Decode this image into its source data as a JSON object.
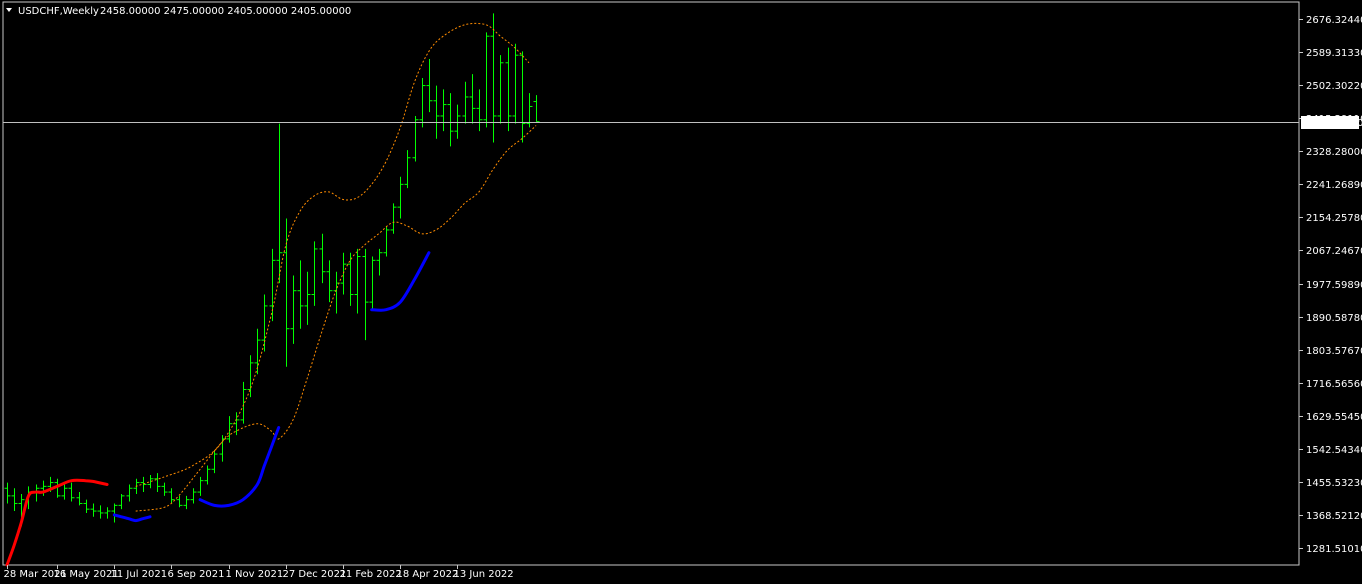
{
  "header": {
    "menu_icon": "triangle-down-icon",
    "title": "USDCHF,Weekly",
    "ohlc": "2458.00000 2475.00000 2405.00000 2405.00000"
  },
  "colors": {
    "background": "#000000",
    "frame": "#c8c8c8",
    "bars": "#00ff00",
    "envelope": "#ff8c00",
    "segment_red": "#ff0000",
    "segment_blue": "#0000ff",
    "current_line": "#c0c0c0",
    "axis_text": "#ffffff",
    "price_label_bg": "#ffffff",
    "price_label_text": "#000000"
  },
  "chart_data": {
    "type": "ohlc",
    "symbol": "USDCHF",
    "timeframe": "Weekly",
    "current_price": 2405.0,
    "current_price_label": "2405.00000",
    "ylim": [
      1238,
      2720
    ],
    "y_ticks": [
      "2676.32440",
      "2589.31330",
      "2502.30220",
      "2415.29110",
      "2328.28000",
      "2241.26890",
      "2154.25780",
      "2067.24670",
      "1977.59890",
      "1890.58780",
      "1803.57670",
      "1716.56560",
      "1629.55450",
      "1542.54340",
      "1455.53230",
      "1368.52120",
      "1281.51010"
    ],
    "x_labels": [
      {
        "label": "28 Mar 2021",
        "bar": 0
      },
      {
        "label": "16 May 2021",
        "bar": 7
      },
      {
        "label": "11 Jul 2021",
        "bar": 15
      },
      {
        "label": "6 Sep 2021",
        "bar": 23
      },
      {
        "label": "1 Nov 2021",
        "bar": 31
      },
      {
        "label": "27 Dec 2021",
        "bar": 39
      },
      {
        "label": "21 Feb 2022",
        "bar": 47
      },
      {
        "label": "18 Apr 2022",
        "bar": 55
      },
      {
        "label": "13 Jun 2022",
        "bar": 63
      }
    ],
    "bars": [
      [
        1440,
        1455,
        1400,
        1420
      ],
      [
        1420,
        1440,
        1380,
        1400
      ],
      [
        1400,
        1425,
        1340,
        1410
      ],
      [
        1410,
        1445,
        1385,
        1430
      ],
      [
        1430,
        1450,
        1405,
        1440
      ],
      [
        1440,
        1460,
        1420,
        1445
      ],
      [
        1445,
        1470,
        1430,
        1455
      ],
      [
        1455,
        1465,
        1415,
        1420
      ],
      [
        1420,
        1450,
        1410,
        1440
      ],
      [
        1440,
        1455,
        1405,
        1415
      ],
      [
        1415,
        1430,
        1395,
        1400
      ],
      [
        1400,
        1410,
        1375,
        1385
      ],
      [
        1385,
        1400,
        1365,
        1380
      ],
      [
        1380,
        1395,
        1360,
        1375
      ],
      [
        1375,
        1390,
        1360,
        1380
      ],
      [
        1380,
        1400,
        1350,
        1395
      ],
      [
        1395,
        1425,
        1385,
        1420
      ],
      [
        1420,
        1450,
        1405,
        1440
      ],
      [
        1440,
        1465,
        1425,
        1455
      ],
      [
        1455,
        1470,
        1430,
        1450
      ],
      [
        1450,
        1475,
        1440,
        1465
      ],
      [
        1465,
        1480,
        1430,
        1445
      ],
      [
        1445,
        1455,
        1420,
        1430
      ],
      [
        1430,
        1440,
        1400,
        1410
      ],
      [
        1410,
        1420,
        1390,
        1395
      ],
      [
        1395,
        1420,
        1385,
        1410
      ],
      [
        1410,
        1440,
        1400,
        1430
      ],
      [
        1430,
        1470,
        1420,
        1460
      ],
      [
        1460,
        1500,
        1450,
        1490
      ],
      [
        1490,
        1540,
        1480,
        1530
      ],
      [
        1530,
        1580,
        1510,
        1570
      ],
      [
        1570,
        1630,
        1560,
        1610
      ],
      [
        1610,
        1640,
        1580,
        1620
      ],
      [
        1620,
        1720,
        1610,
        1700
      ],
      [
        1700,
        1790,
        1680,
        1770
      ],
      [
        1770,
        1860,
        1740,
        1830
      ],
      [
        1830,
        1950,
        1800,
        1920
      ],
      [
        1920,
        2070,
        1880,
        2040
      ],
      [
        2040,
        2400,
        1980,
        2060
      ],
      [
        2060,
        2150,
        1760,
        1860
      ],
      [
        1860,
        2000,
        1820,
        1960
      ],
      [
        1960,
        2040,
        1860,
        1920
      ],
      [
        1920,
        2010,
        1870,
        1950
      ],
      [
        1950,
        2090,
        1920,
        2070
      ],
      [
        2070,
        2110,
        1980,
        2010
      ],
      [
        2010,
        2040,
        1930,
        1960
      ],
      [
        1960,
        2010,
        1900,
        1980
      ],
      [
        1980,
        2060,
        1950,
        2030
      ],
      [
        2030,
        2060,
        1920,
        1950
      ],
      [
        1950,
        2070,
        1900,
        2050
      ],
      [
        2050,
        2070,
        1830,
        1930
      ],
      [
        1930,
        2050,
        1910,
        2040
      ],
      [
        2040,
        2070,
        2000,
        2060
      ],
      [
        2060,
        2130,
        2050,
        2120
      ],
      [
        2120,
        2190,
        2110,
        2180
      ],
      [
        2180,
        2260,
        2150,
        2240
      ],
      [
        2240,
        2330,
        2230,
        2310
      ],
      [
        2310,
        2420,
        2300,
        2410
      ],
      [
        2410,
        2520,
        2390,
        2500
      ],
      [
        2500,
        2570,
        2430,
        2460
      ],
      [
        2460,
        2500,
        2360,
        2420
      ],
      [
        2420,
        2490,
        2380,
        2450
      ],
      [
        2450,
        2480,
        2340,
        2380
      ],
      [
        2380,
        2450,
        2360,
        2420
      ],
      [
        2420,
        2510,
        2400,
        2470
      ],
      [
        2470,
        2530,
        2400,
        2440
      ],
      [
        2440,
        2490,
        2380,
        2410
      ],
      [
        2410,
        2640,
        2390,
        2630
      ],
      [
        2630,
        2690,
        2350,
        2420
      ],
      [
        2420,
        2580,
        2400,
        2560
      ],
      [
        2560,
        2600,
        2380,
        2420
      ],
      [
        2420,
        2610,
        2400,
        2580
      ],
      [
        2580,
        2590,
        2350,
        2400
      ],
      [
        2400,
        2480,
        2390,
        2445
      ],
      [
        2458,
        2475,
        2405,
        2405
      ]
    ],
    "envelope_upper_knots": [
      [
        18,
        1445
      ],
      [
        22,
        1470
      ],
      [
        26,
        1500
      ],
      [
        30,
        1560
      ],
      [
        34,
        1700
      ],
      [
        37,
        1900
      ],
      [
        39,
        2080
      ],
      [
        41,
        2170
      ],
      [
        43,
        2210
      ],
      [
        45,
        2220
      ],
      [
        47,
        2200
      ],
      [
        49,
        2205
      ],
      [
        51,
        2240
      ],
      [
        53,
        2300
      ],
      [
        55,
        2390
      ],
      [
        57,
        2510
      ],
      [
        59,
        2590
      ],
      [
        61,
        2630
      ],
      [
        64,
        2660
      ],
      [
        67,
        2660
      ],
      [
        69,
        2630
      ],
      [
        71,
        2600
      ],
      [
        73,
        2560
      ]
    ],
    "envelope_lower_knots": [
      [
        18,
        1380
      ],
      [
        22,
        1390
      ],
      [
        24,
        1420
      ],
      [
        27,
        1490
      ],
      [
        30,
        1560
      ],
      [
        32,
        1590
      ],
      [
        35,
        1610
      ],
      [
        37,
        1590
      ],
      [
        38,
        1570
      ],
      [
        40,
        1620
      ],
      [
        42,
        1730
      ],
      [
        44,
        1850
      ],
      [
        46,
        1960
      ],
      [
        48,
        2040
      ],
      [
        50,
        2080
      ],
      [
        52,
        2110
      ],
      [
        54,
        2140
      ],
      [
        56,
        2130
      ],
      [
        58,
        2110
      ],
      [
        60,
        2120
      ],
      [
        62,
        2150
      ],
      [
        64,
        2190
      ],
      [
        66,
        2220
      ],
      [
        68,
        2280
      ],
      [
        70,
        2330
      ],
      [
        72,
        2360
      ],
      [
        74,
        2395
      ]
    ],
    "red_segment_knots": [
      [
        0,
        1238
      ],
      [
        1,
        1290
      ],
      [
        2,
        1350
      ],
      [
        3,
        1420
      ],
      [
        4,
        1430
      ],
      [
        5,
        1430
      ],
      [
        7,
        1445
      ],
      [
        9,
        1460
      ],
      [
        11,
        1460
      ],
      [
        12,
        1458
      ],
      [
        14,
        1450
      ]
    ],
    "blue_segment_1_knots": [
      [
        15,
        1370
      ],
      [
        16,
        1365
      ],
      [
        17,
        1360
      ],
      [
        18,
        1355
      ],
      [
        19,
        1360
      ],
      [
        20,
        1365
      ]
    ],
    "blue_segment_2_knots": [
      [
        27,
        1410
      ],
      [
        29,
        1395
      ],
      [
        31,
        1395
      ],
      [
        33,
        1410
      ],
      [
        35,
        1450
      ],
      [
        36,
        1500
      ],
      [
        37,
        1550
      ],
      [
        38,
        1600
      ]
    ],
    "blue_segment_3_knots": [
      [
        51,
        1910
      ],
      [
        53,
        1910
      ],
      [
        55,
        1930
      ],
      [
        57,
        1990
      ],
      [
        59,
        2060
      ]
    ]
  }
}
